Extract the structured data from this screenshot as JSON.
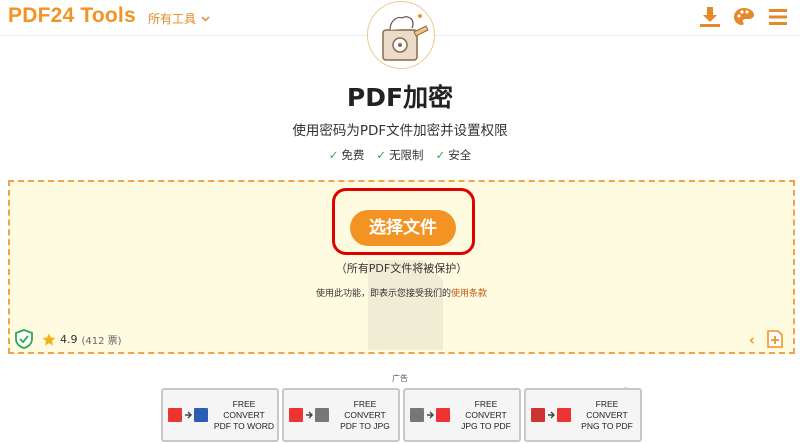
{
  "header": {
    "logo": "PDF24 Tools",
    "all_tools": "所有工具"
  },
  "page": {
    "title": "PDF加密",
    "subtitle": "使用密码为PDF文件加密并设置权限",
    "features": [
      "免费",
      "无限制",
      "安全"
    ]
  },
  "dropzone": {
    "choose_button": "选择文件",
    "protected_note": "（所有PDF文件将被保护）",
    "terms_prefix": "使用此功能，即表示您接受我们的",
    "terms_link": "使用条款",
    "rating_value": "4.9",
    "rating_votes": "(412 票)"
  },
  "ads": {
    "label": "广告",
    "items": [
      {
        "line1": "FREE CONVERT",
        "line2": "PDF TO WORD",
        "from": "PDF",
        "to": "W"
      },
      {
        "line1": "FREE CONVERT",
        "line2": "PDF TO JPG",
        "from": "PDF",
        "to": "JPG"
      },
      {
        "line1": "FREE CONVERT",
        "line2": "JPG TO PDF",
        "from": "JPG",
        "to": "PDF"
      },
      {
        "line1": "FREE CONVERT",
        "line2": "PNG TO PDF",
        "from": "PNG",
        "to": "PDF"
      }
    ]
  },
  "colors": {
    "brand": "#f39323",
    "dropzone_bg": "#fffbe0",
    "highlight": "#e00000",
    "check": "#2fa84f"
  }
}
